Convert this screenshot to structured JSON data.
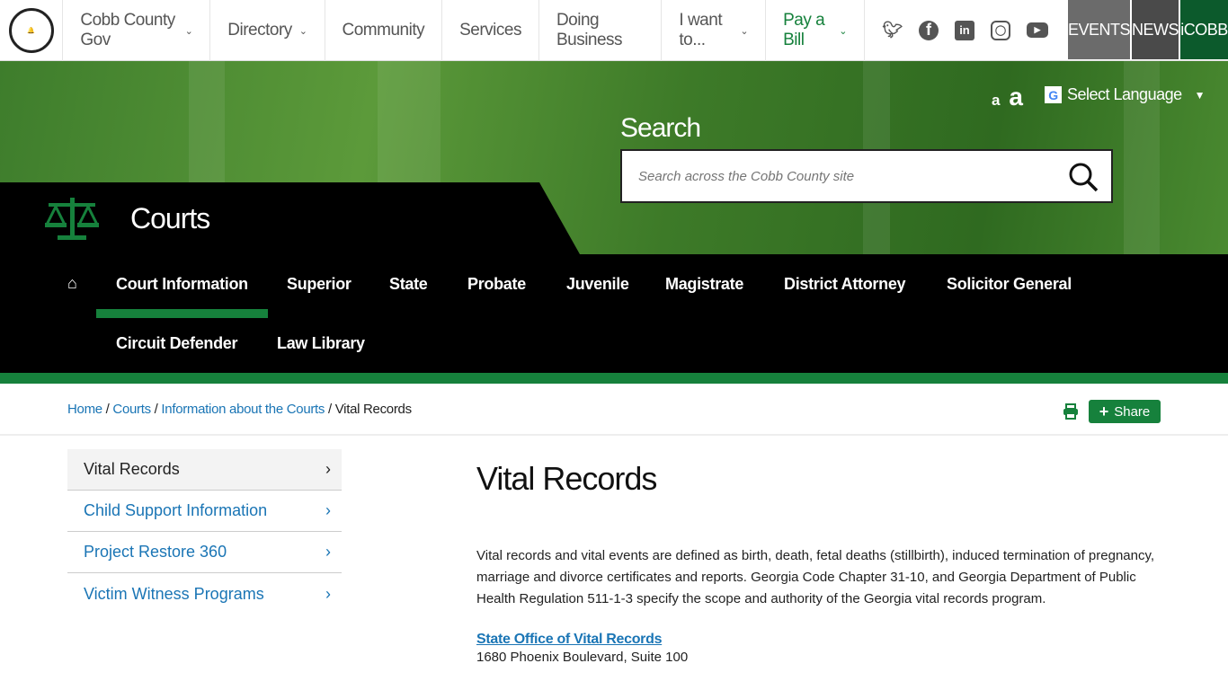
{
  "header": {
    "logo_text": "COBB COUNTY STATE OF GEORGIA",
    "nav": [
      {
        "label": "Cobb County Gov",
        "dropdown": true
      },
      {
        "label": "Directory",
        "dropdown": true
      },
      {
        "label": "Community"
      },
      {
        "label": "Services"
      },
      {
        "label": "Doing Business"
      },
      {
        "label": "I want to...",
        "dropdown": true
      },
      {
        "label": "Pay a Bill",
        "dropdown": true
      }
    ],
    "social": [
      "twitter-icon",
      "facebook-icon",
      "linkedin-icon",
      "instagram-icon",
      "youtube-icon"
    ],
    "pills": [
      {
        "label": "EVENTS",
        "color": "#6b6b6b"
      },
      {
        "label": "NEWS",
        "color": "#4a4a4a"
      },
      {
        "label": "iCOBB",
        "color": "#0c5a2c"
      }
    ]
  },
  "hero": {
    "text_small": "a",
    "text_large": "a",
    "language": "Select Language",
    "search_label": "Search",
    "search_placeholder": "Search across the Cobb County site",
    "section_title": "Courts"
  },
  "subnav": [
    "Court Information",
    "Superior",
    "State",
    "Probate",
    "Juvenile",
    "Magistrate",
    "District Attorney",
    "Solicitor General",
    "Circuit Defender",
    "Law Library"
  ],
  "breadcrumb": {
    "items": [
      "Home",
      "Courts",
      "Information about the Courts"
    ],
    "current": "Vital Records"
  },
  "share_label": "Share",
  "sidebar": [
    "Vital Records",
    "Child Support Information",
    "Project Restore 360",
    "Victim Witness Programs"
  ],
  "main": {
    "title": "Vital Records",
    "body": "Vital records and vital events are defined as birth, death, fetal deaths (stillbirth), induced termination of pregnancy, marriage and divorce certificates and reports. Georgia Code Chapter 31-10, and Georgia Department of Public Health Regulation 511-1-3 specify the scope and authority of the Georgia vital records program.",
    "link": "State Office of Vital Records",
    "address": "1680 Phoenix Boulevard, Suite 100"
  },
  "colors": {
    "brand_green": "#16813c",
    "link_blue": "#1a75b5"
  }
}
